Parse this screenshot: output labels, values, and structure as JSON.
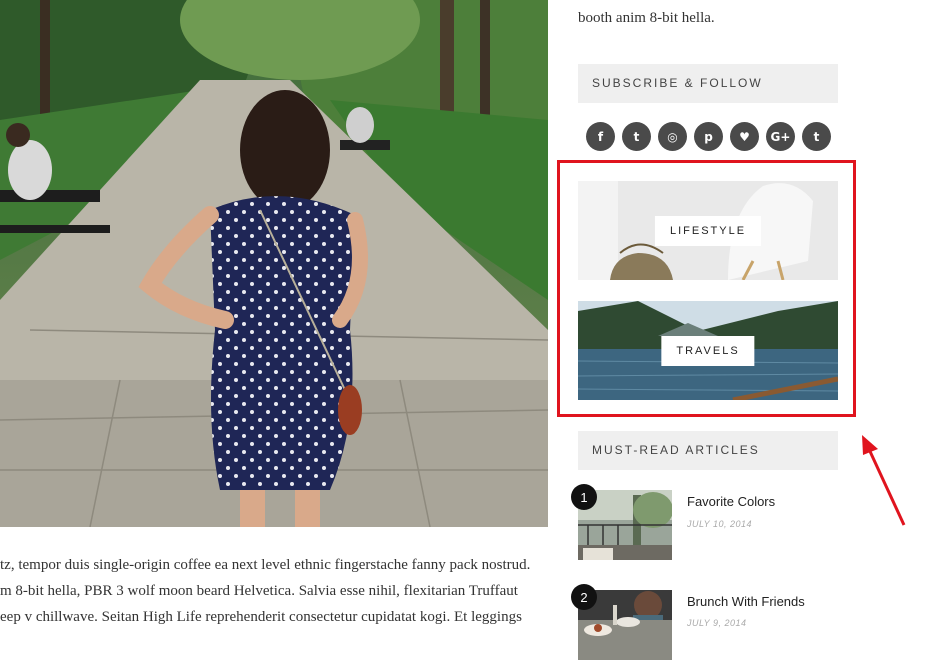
{
  "main": {
    "paragraph_lines": [
      "tz, tempor duis single-origin coffee ea next level ethnic fingerstache fanny pack nostrud.",
      "m 8-bit hella, PBR 3 wolf moon beard Helvetica. Salvia esse nihil, flexitarian Truffaut",
      "eep v chillwave. Seitan High Life reprehenderit consectetur cupidatat kogi. Et leggings"
    ]
  },
  "sidebar": {
    "top_snippet": "booth anim 8-bit hella.",
    "subscribe_title": "SUBSCRIBE & FOLLOW",
    "social_icons": [
      {
        "name": "facebook-icon",
        "glyph": "f"
      },
      {
        "name": "twitter-icon",
        "glyph": "t"
      },
      {
        "name": "instagram-icon",
        "glyph": "◎"
      },
      {
        "name": "pinterest-icon",
        "glyph": "p"
      },
      {
        "name": "bloglovin-heart-icon",
        "glyph": "♥"
      },
      {
        "name": "google-plus-icon",
        "glyph": "G+"
      },
      {
        "name": "tumblr-icon",
        "glyph": "t"
      }
    ],
    "categories": [
      {
        "label": "LIFESTYLE"
      },
      {
        "label": "TRAVELS"
      }
    ],
    "must_read_title": "MUST-READ ARTICLES",
    "articles": [
      {
        "rank": "1",
        "title": "Favorite Colors",
        "date": "JULY 10, 2014"
      },
      {
        "rank": "2",
        "title": "Brunch With Friends",
        "date": "JULY 9, 2014"
      }
    ]
  },
  "colors": {
    "highlight": "#e0141e",
    "widget_bg": "#efefef",
    "icon_bg": "#4a4a4a"
  }
}
